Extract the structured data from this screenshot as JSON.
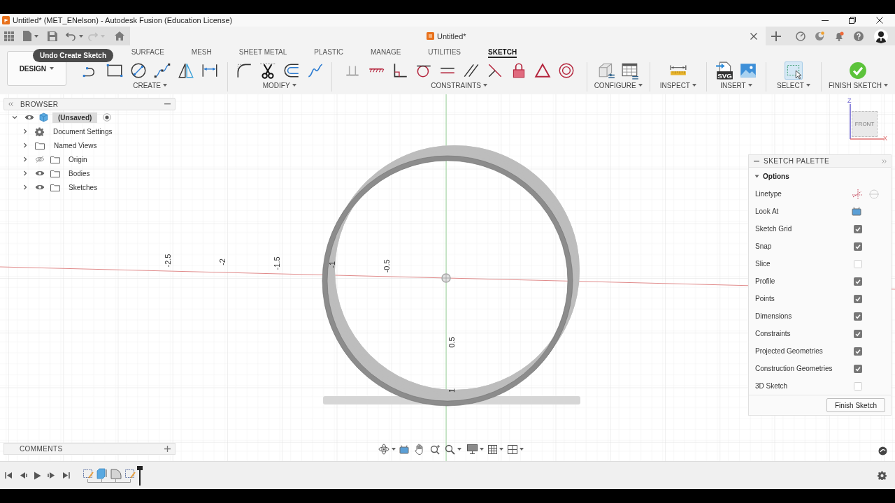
{
  "window": {
    "icon_text": "F",
    "title": "Untitled* (MET_ENelson) - Autodesk Fusion (Education License)"
  },
  "history": {
    "undo_disabled": false,
    "redo_disabled": true
  },
  "document_tab": {
    "title": "Untitled*"
  },
  "tooltip": "Undo Create Sketch",
  "workspace": {
    "label": "DESIGN"
  },
  "toolbar_tabs": [
    {
      "label": "SURFACE",
      "selected": false
    },
    {
      "label": "MESH",
      "selected": false
    },
    {
      "label": "SHEET METAL",
      "selected": false
    },
    {
      "label": "PLASTIC",
      "selected": false
    },
    {
      "label": "MANAGE",
      "selected": false
    },
    {
      "label": "UTILITIES",
      "selected": false
    },
    {
      "label": "SKETCH",
      "selected": true
    }
  ],
  "tool_groups": [
    {
      "label": "CREATE",
      "active": false
    },
    {
      "label": "MODIFY",
      "active": false
    },
    {
      "label": "CONSTRAINTS",
      "active": false
    },
    {
      "label": "CONFIGURE",
      "active": false
    },
    {
      "label": "INSPECT",
      "active": false
    },
    {
      "label": "INSERT",
      "active": false,
      "icon_text": "SVG"
    },
    {
      "label": "SELECT",
      "active": true
    },
    {
      "label": "FINISH SKETCH",
      "active": false
    }
  ],
  "browser": {
    "title": "BROWSER",
    "root": {
      "label": "(Unsaved)",
      "kind": "component",
      "expanded": true,
      "visible": true,
      "active": true,
      "children": [
        {
          "label": "Document Settings",
          "kind": "settings",
          "expanded": false
        },
        {
          "label": "Named Views",
          "kind": "folder",
          "expanded": false
        },
        {
          "label": "Origin",
          "kind": "folder",
          "expanded": false,
          "visible": false
        },
        {
          "label": "Bodies",
          "kind": "folder",
          "expanded": false,
          "visible": true
        },
        {
          "label": "Sketches",
          "kind": "folder",
          "expanded": false,
          "visible": true
        }
      ]
    }
  },
  "canvas": {
    "x_axis_labels": [
      "-2.5",
      "-2",
      "-1.5",
      "-1",
      "-0.5"
    ],
    "z_axis_labels": [
      "0.5",
      "1"
    ]
  },
  "view_cube": {
    "face": "FRONT",
    "vertical_axis": "Z",
    "horizontal_axis": "X"
  },
  "sketch_palette": {
    "title": "SKETCH PALETTE",
    "section": {
      "label": "Options",
      "expanded": true
    },
    "rows": [
      {
        "label": "Linetype",
        "kind": "linetype"
      },
      {
        "label": "Look At",
        "kind": "look_at"
      },
      {
        "label": "Sketch Grid",
        "kind": "checkbox",
        "checked": true
      },
      {
        "label": "Snap",
        "kind": "checkbox",
        "checked": true
      },
      {
        "label": "Slice",
        "kind": "checkbox",
        "checked": false
      },
      {
        "label": "Profile",
        "kind": "checkbox",
        "checked": true
      },
      {
        "label": "Points",
        "kind": "checkbox",
        "checked": true
      },
      {
        "label": "Dimensions",
        "kind": "checkbox",
        "checked": true
      },
      {
        "label": "Constraints",
        "kind": "checkbox",
        "checked": true
      },
      {
        "label": "Projected Geometries",
        "kind": "checkbox",
        "checked": true
      },
      {
        "label": "Construction Geometries",
        "kind": "checkbox",
        "checked": true
      },
      {
        "label": "3D Sketch",
        "kind": "checkbox",
        "checked": false
      }
    ],
    "button": "Finish Sketch"
  },
  "comments": {
    "title": "COMMENTS"
  }
}
